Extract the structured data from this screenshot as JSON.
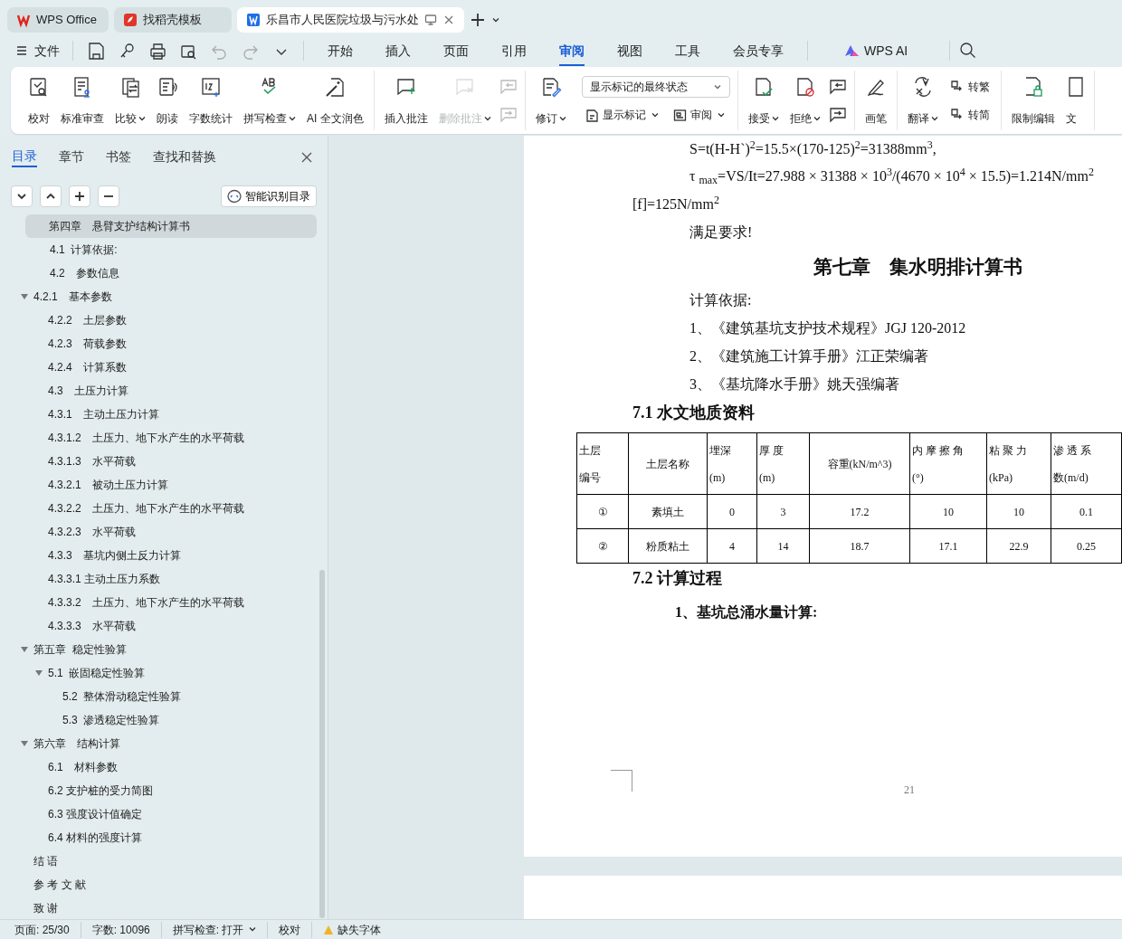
{
  "window_tabs": [
    {
      "label": "WPS Office",
      "selected": false
    },
    {
      "label": "找稻壳模板",
      "selected": false
    },
    {
      "label": "乐昌市人民医院垃圾与污水处",
      "selected": true
    }
  ],
  "quick_access": {
    "file_label": "文件"
  },
  "menu_tabs": [
    {
      "label": "开始",
      "selected": false
    },
    {
      "label": "插入",
      "selected": false
    },
    {
      "label": "页面",
      "selected": false
    },
    {
      "label": "引用",
      "selected": false
    },
    {
      "label": "审阅",
      "selected": true
    },
    {
      "label": "视图",
      "selected": false
    },
    {
      "label": "工具",
      "selected": false
    },
    {
      "label": "会员专享",
      "selected": false
    }
  ],
  "ai_label": "WPS AI",
  "ribbon": [
    {
      "items": [
        {
          "kind": "large",
          "label": "校对",
          "dropdown": false,
          "disabled": false
        },
        {
          "kind": "large",
          "label": "标准审查",
          "dropdown": false,
          "disabled": false
        },
        {
          "kind": "large",
          "label": "比较",
          "dropdown": true,
          "disabled": false
        },
        {
          "kind": "large",
          "label": "朗读",
          "dropdown": false,
          "disabled": false
        },
        {
          "kind": "large",
          "label": "字数统计",
          "dropdown": false,
          "disabled": false
        },
        {
          "kind": "large",
          "label": "拼写检查",
          "dropdown": true,
          "disabled": false
        },
        {
          "kind": "large",
          "label": "AI 全文润色",
          "dropdown": false,
          "disabled": false
        }
      ]
    },
    {
      "items": [
        {
          "kind": "large",
          "label": "插入批注",
          "dropdown": false,
          "disabled": false
        },
        {
          "kind": "large",
          "label": "删除批注",
          "dropdown": true,
          "disabled": true
        },
        {
          "kind": "icon-pair",
          "disabled": true
        }
      ]
    },
    {
      "items": [
        {
          "kind": "large",
          "label": "修订",
          "dropdown": true,
          "disabled": false
        },
        {
          "kind": "select-stack",
          "value": "显示标记的最终状态",
          "buttons": [
            {
              "label": "显示标记",
              "dropdown": true
            },
            {
              "label": "审阅",
              "dropdown": true
            }
          ]
        }
      ]
    },
    {
      "items": [
        {
          "kind": "large",
          "label": "接受",
          "dropdown": true,
          "disabled": false
        },
        {
          "kind": "large",
          "label": "拒绝",
          "dropdown": true,
          "disabled": false
        },
        {
          "kind": "icon-pair",
          "disabled": false
        }
      ]
    },
    {
      "items": [
        {
          "kind": "large",
          "label": "画笔",
          "dropdown": false,
          "disabled": false
        }
      ]
    },
    {
      "items": [
        {
          "kind": "large",
          "label": "翻译",
          "dropdown": true,
          "disabled": false
        },
        {
          "kind": "stack",
          "buttons": [
            {
              "label": "转繁",
              "dropdown": false
            },
            {
              "label": "转简",
              "dropdown": false
            }
          ]
        }
      ]
    },
    {
      "items": [
        {
          "kind": "large",
          "label": "限制编辑",
          "dropdown": false,
          "disabled": false
        },
        {
          "kind": "large",
          "label": "文",
          "dropdown": false,
          "disabled": false
        }
      ]
    }
  ],
  "sidebar": {
    "tabs": [
      {
        "label": "目录",
        "selected": true
      },
      {
        "label": "章节",
        "selected": false
      },
      {
        "label": "书签",
        "selected": false
      },
      {
        "label": "查找和替换",
        "selected": false
      }
    ],
    "smart_button": "智能识别目录",
    "outline": [
      {
        "label": "第四章　悬臂支护结构计算书",
        "selected": true
      },
      {
        "label": "4.1  计算依据:",
        "selected": false
      },
      {
        "label": "4.2　参数信息",
        "selected": false
      },
      {
        "label": "4.2.1　基本参数",
        "selected": false,
        "expanded": true,
        "children": [
          {
            "label": "4.2.2　土层参数",
            "selected": false
          },
          {
            "label": "4.2.3　荷载参数",
            "selected": false
          },
          {
            "label": "4.2.4　计算系数",
            "selected": false
          },
          {
            "label": "4.3　土压力计算",
            "selected": false
          },
          {
            "label": "4.3.1　主动土压力计算",
            "selected": false
          },
          {
            "label": "4.3.1.2　土压力、地下水产生的水平荷载",
            "selected": false
          },
          {
            "label": "4.3.1.3　水平荷载",
            "selected": false
          },
          {
            "label": "4.3.2.1　被动土压力计算",
            "selected": false
          },
          {
            "label": "4.3.2.2　土压力、地下水产生的水平荷载",
            "selected": false
          },
          {
            "label": "4.3.2.3　水平荷载",
            "selected": false
          },
          {
            "label": "4.3.3　基坑内侧土反力计算",
            "selected": false
          },
          {
            "label": "4.3.3.1 主动土压力系数",
            "selected": false
          },
          {
            "label": "4.3.3.2　土压力、地下水产生的水平荷载",
            "selected": false
          },
          {
            "label": "4.3.3.3　水平荷载",
            "selected": false
          }
        ]
      },
      {
        "label": "第五章  稳定性验算",
        "selected": false,
        "expanded": true,
        "children": [
          {
            "label": "5.1  嵌固稳定性验算",
            "selected": false,
            "expanded": true,
            "children": [
              {
                "label": "5.2  整体滑动稳定性验算",
                "selected": false
              },
              {
                "label": "5.3  渗透稳定性验算",
                "selected": false
              }
            ]
          }
        ]
      },
      {
        "label": "第六章　结构计算",
        "selected": false,
        "expanded": true,
        "children": [
          {
            "label": "6.1　材料参数",
            "selected": false
          },
          {
            "label": "6.2 支护桩的受力简图",
            "selected": false
          },
          {
            "label": "6.3 强度设计值确定",
            "selected": false
          },
          {
            "label": "6.4 材料的强度计算",
            "selected": false
          }
        ]
      },
      {
        "label": "结 语",
        "selected": false
      },
      {
        "label": "参 考 文 献",
        "selected": false
      },
      {
        "label": "致 谢",
        "selected": false
      }
    ]
  },
  "document": {
    "blocks": [
      {
        "kind": "formula",
        "text": "S=t(H-H`)$^{2}$=15.5×(170-125)$^{2}$=31388mm$^{3}$,"
      },
      {
        "kind": "formula",
        "text": "τ $_{max}$=VS/It=27.988 × 31388 × 10$^{3}$/(4670 × 10$^{4}$ × 15.5)=1.214N/mm$^{2}$"
      },
      {
        "kind": "flush",
        "text": "[f]=125N/mm$^{2}$"
      },
      {
        "kind": "para",
        "text": "满足要求!"
      },
      {
        "kind": "chapter",
        "text": "第七章　集水明排计算书"
      },
      {
        "kind": "para",
        "text": "计算依据:"
      },
      {
        "kind": "para",
        "text": "1、《建筑基坑支护技术规程》JGJ 120-2012"
      },
      {
        "kind": "para",
        "text": "2、《建筑施工计算手册》江正荣编著"
      },
      {
        "kind": "para",
        "text": "3、《基坑降水手册》姚天强编著"
      },
      {
        "kind": "heading",
        "text": "7.1 水文地质资料"
      },
      {
        "kind": "table",
        "columns": [
          "土层编号",
          "土层名称",
          "埋深\n(m)",
          "厚 度\n(m)",
          "容重(kN/m^3)",
          "内 摩 擦 角\n(°)",
          "粘 聚 力\n(kPa)",
          "渗 透 系数(m/d)"
        ],
        "rows": [
          [
            "①",
            "素填土",
            "0",
            "3",
            "17.2",
            "10",
            "10",
            "0.1"
          ],
          [
            "②",
            "粉质粘土",
            "4",
            "14",
            "18.7",
            "17.1",
            "22.9",
            "0.25"
          ]
        ]
      },
      {
        "kind": "heading",
        "text": "7.2  计算过程"
      },
      {
        "kind": "subheading",
        "text": "1、基坑总涌水量计算:"
      }
    ],
    "page_number": "21"
  },
  "status_bar": [
    {
      "kind": "text",
      "label": "页面: 25/30"
    },
    {
      "kind": "text",
      "label": "字数: 10096"
    },
    {
      "kind": "menu",
      "label": "拼写检查: 打开"
    },
    {
      "kind": "text",
      "label": "校对"
    },
    {
      "kind": "warning",
      "label": "缺失字体"
    }
  ]
}
